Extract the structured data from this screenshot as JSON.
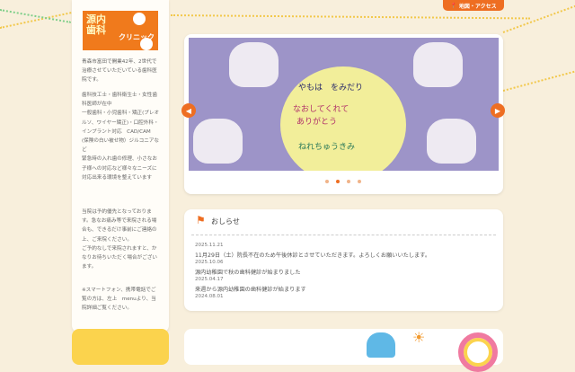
{
  "header": {
    "access_label": "地図・アクセス"
  },
  "sidebar": {
    "logo_line1": "源内",
    "logo_line2": "歯科",
    "logo_line3": "クリニック",
    "paragraphs": [
      "青森市富田で開業42年、2世代で治療させていただいている歯科医院です。",
      "歯科技工士・歯科衛生士・女性歯科医師が在中\n一般歯科・小児歯科・矯正(プレオルソ、ワイヤー矯正)・口腔外科・インプラント対応　CAD/CAM　(保険の白い被せ物）ジルコニアなど\n緊急時の入れ歯の修理、小さなお子様への対応など様々なニーズに対応出来る環境を整えています",
      "当院は予約優先となっております。急なお痛み等で来院される場合も、できるだけ事前にご連絡の上、ご来院ください。\nご予約なしで来院されますと、かなりお待ちいただく場合がございます。",
      "※スマートフォン、携帯電話でご覧の方は、左上　menuより、当院詳細ご覧ください。"
    ]
  },
  "slider": {
    "plate_text": [
      "やもは　をみだり",
      "なおしてくれて",
      "ありがとう",
      "ねれちゅうきみ"
    ],
    "current": 2,
    "count": 4
  },
  "news": {
    "title": "おしらせ",
    "items": [
      {
        "date": "2025.11.21",
        "text": "11月29日（土）院長不在のため午後休診とさせていただきます。よろしくお願いいたします。"
      },
      {
        "date": "2025.10.06",
        "text": "源内幼稚園で秋の歯科健診が始まりました"
      },
      {
        "date": "2025.04.17",
        "text": "来週から源内幼稚園の歯科健診が始まります"
      },
      {
        "date": "2024.08.01",
        "text": ""
      }
    ]
  },
  "colors": {
    "accent": "#ee6e22",
    "background": "#f8efdc"
  }
}
